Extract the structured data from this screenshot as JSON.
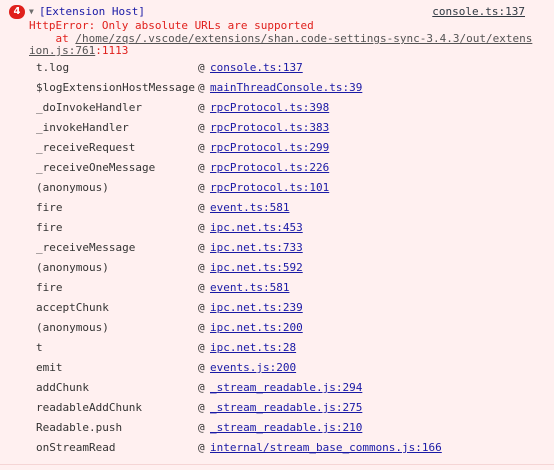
{
  "entry": {
    "count": "4",
    "context": "[Extension Host]",
    "source": "console.ts:137",
    "message": "HttpError: Only absolute URLs are supported",
    "at_prefix": "    at ",
    "location_path_part1": "/home/zqs/.vscode/extensions/shan.code-settings-sync-3.4.3/out/extens",
    "location_path_part2": "ion.js:761",
    "location_suffix": ":1113"
  },
  "stack": [
    {
      "fn": "t.log",
      "at": "@",
      "link": "console.ts:137"
    },
    {
      "fn": "$logExtensionHostMessage",
      "at": "@",
      "link": "mainThreadConsole.ts:39"
    },
    {
      "fn": "_doInvokeHandler",
      "at": "@",
      "link": "rpcProtocol.ts:398"
    },
    {
      "fn": "_invokeHandler",
      "at": "@",
      "link": "rpcProtocol.ts:383"
    },
    {
      "fn": "_receiveRequest",
      "at": "@",
      "link": "rpcProtocol.ts:299"
    },
    {
      "fn": "_receiveOneMessage",
      "at": "@",
      "link": "rpcProtocol.ts:226"
    },
    {
      "fn": "(anonymous)",
      "at": "@",
      "link": "rpcProtocol.ts:101"
    },
    {
      "fn": "fire",
      "at": "@",
      "link": "event.ts:581"
    },
    {
      "fn": "fire",
      "at": "@",
      "link": "ipc.net.ts:453"
    },
    {
      "fn": "_receiveMessage",
      "at": "@",
      "link": "ipc.net.ts:733"
    },
    {
      "fn": "(anonymous)",
      "at": "@",
      "link": "ipc.net.ts:592"
    },
    {
      "fn": "fire",
      "at": "@",
      "link": "event.ts:581"
    },
    {
      "fn": "acceptChunk",
      "at": "@",
      "link": "ipc.net.ts:239"
    },
    {
      "fn": "(anonymous)",
      "at": "@",
      "link": "ipc.net.ts:200"
    },
    {
      "fn": "t",
      "at": "@",
      "link": "ipc.net.ts:28"
    },
    {
      "fn": "emit",
      "at": "@",
      "link": "events.js:200"
    },
    {
      "fn": "addChunk",
      "at": "@",
      "link": "_stream_readable.js:294"
    },
    {
      "fn": "readableAddChunk",
      "at": "@",
      "link": "_stream_readable.js:275"
    },
    {
      "fn": "Readable.push",
      "at": "@",
      "link": "_stream_readable.js:210"
    },
    {
      "fn": "onStreamRead",
      "at": "@",
      "link": "internal/stream_base_commons.js:166"
    }
  ],
  "colors": {
    "background": "#fff0f0",
    "error_text": "#e0201c",
    "link": "#1a1aa6",
    "badge": "#e0201c"
  }
}
